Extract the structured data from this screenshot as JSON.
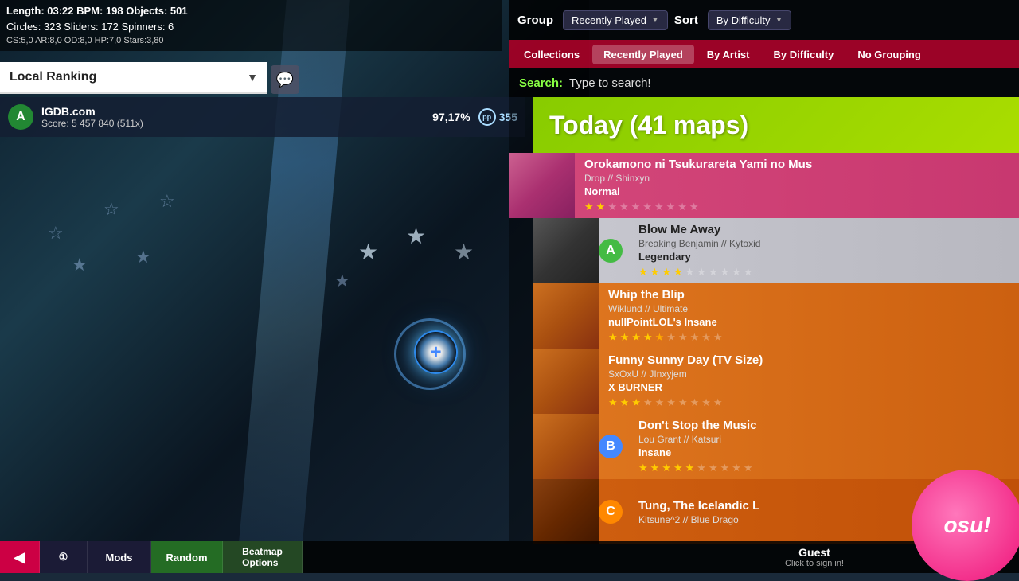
{
  "top_info": {
    "line1": "Length: 03:22  BPM: 198  Objects: 501",
    "line2": "Circles: 323  Sliders: 172  Spinners: 6",
    "line3": "CS:5,0  AR:8,0  OD:8,0  HP:7,0  Stars:3,80"
  },
  "group_sort": {
    "group_label": "Group",
    "sort_label": "Sort",
    "group_value": "Recently Played",
    "sort_value": "By Difficulty"
  },
  "filter_buttons": [
    {
      "label": "Collections",
      "active": false
    },
    {
      "label": "Recently Played",
      "active": true
    },
    {
      "label": "By Artist",
      "active": false
    },
    {
      "label": "By Difficulty",
      "active": false
    },
    {
      "label": "No Grouping",
      "active": false
    }
  ],
  "search": {
    "label": "Search:",
    "placeholder": "Type to search!"
  },
  "today_header": {
    "text": "Today (41 maps)"
  },
  "songs": [
    {
      "id": 1,
      "title": "Orokamono ni Tsukurareta Yami no Mus",
      "artist_mapper": "Drop // Shinxyn",
      "difficulty": "Normal",
      "stars_filled": 2,
      "stars_total": 10,
      "color": "pink",
      "grade": ""
    },
    {
      "id": 2,
      "title": "Blow Me Away",
      "artist_mapper": "Breaking Benjamin // Kytoxid",
      "difficulty": "Legendary",
      "stars_filled": 4,
      "stars_total": 10,
      "color": "white",
      "grade": "A"
    },
    {
      "id": 3,
      "title": "Whip the Blip",
      "artist_mapper": "Wiklund // Ultimate",
      "difficulty": "nullPointLOL's Insane",
      "stars_filled": 4,
      "stars_half": 1,
      "stars_total": 10,
      "color": "orange",
      "grade": ""
    },
    {
      "id": 4,
      "title": "Funny Sunny Day (TV Size)",
      "artist_mapper": "SxOxU // JInxyjem",
      "difficulty": "X BURNER",
      "stars_filled": 3,
      "stars_total": 10,
      "color": "orange",
      "grade": ""
    },
    {
      "id": 5,
      "title": "Don't Stop the Music",
      "artist_mapper": "Lou Grant // Katsuri",
      "difficulty": "Insane",
      "stars_filled": 5,
      "stars_total": 10,
      "color": "orange",
      "grade": "B"
    },
    {
      "id": 6,
      "title": "Tung, The Icelandic L",
      "artist_mapper": "Kitsune^2 // Blue Drago",
      "difficulty": "",
      "stars_filled": 0,
      "stars_total": 0,
      "color": "dark-orange",
      "grade": "C"
    }
  ],
  "local_ranking": {
    "label": "Local Ranking",
    "dropdown_arrow": "▼"
  },
  "score": {
    "player": "IGDB.com",
    "score_value": "5 457 840 (511x)",
    "accuracy": "97,17%",
    "pp_value": "355",
    "grade": "A"
  },
  "bottom_bar": {
    "back": "◀",
    "mode_icon": "①",
    "mods": "Mods",
    "random": "Random",
    "beatmap": "Beatmap\nOptions"
  },
  "guest": {
    "name": "Guest",
    "sub": "Click to sign in!"
  },
  "osu_logo": "osu!"
}
